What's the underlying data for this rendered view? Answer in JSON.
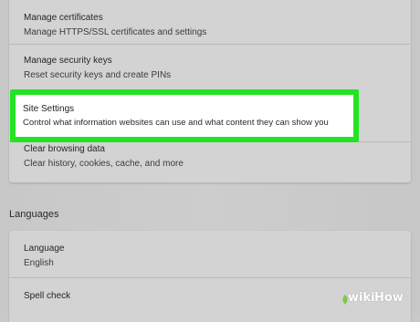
{
  "settings_list": {
    "items": [
      {
        "title": "Manage certificates",
        "desc": "Manage HTTPS/SSL certificates and settings"
      },
      {
        "title": "Manage security keys",
        "desc": "Reset security keys and create PINs"
      },
      {
        "title": "Site Settings",
        "desc": "Control what information websites can use and what content they can show you"
      },
      {
        "title": "Clear browsing data",
        "desc": "Clear history, cookies, cache, and more"
      }
    ]
  },
  "languages": {
    "heading": "Languages",
    "items": [
      {
        "title": "Language",
        "desc": "English"
      },
      {
        "title": "Spell check"
      }
    ]
  },
  "highlight": {
    "color": "#24e324"
  },
  "watermark": {
    "wiki": "wiki",
    "how": "How",
    "logo": "wikihow-leaf-icon"
  }
}
